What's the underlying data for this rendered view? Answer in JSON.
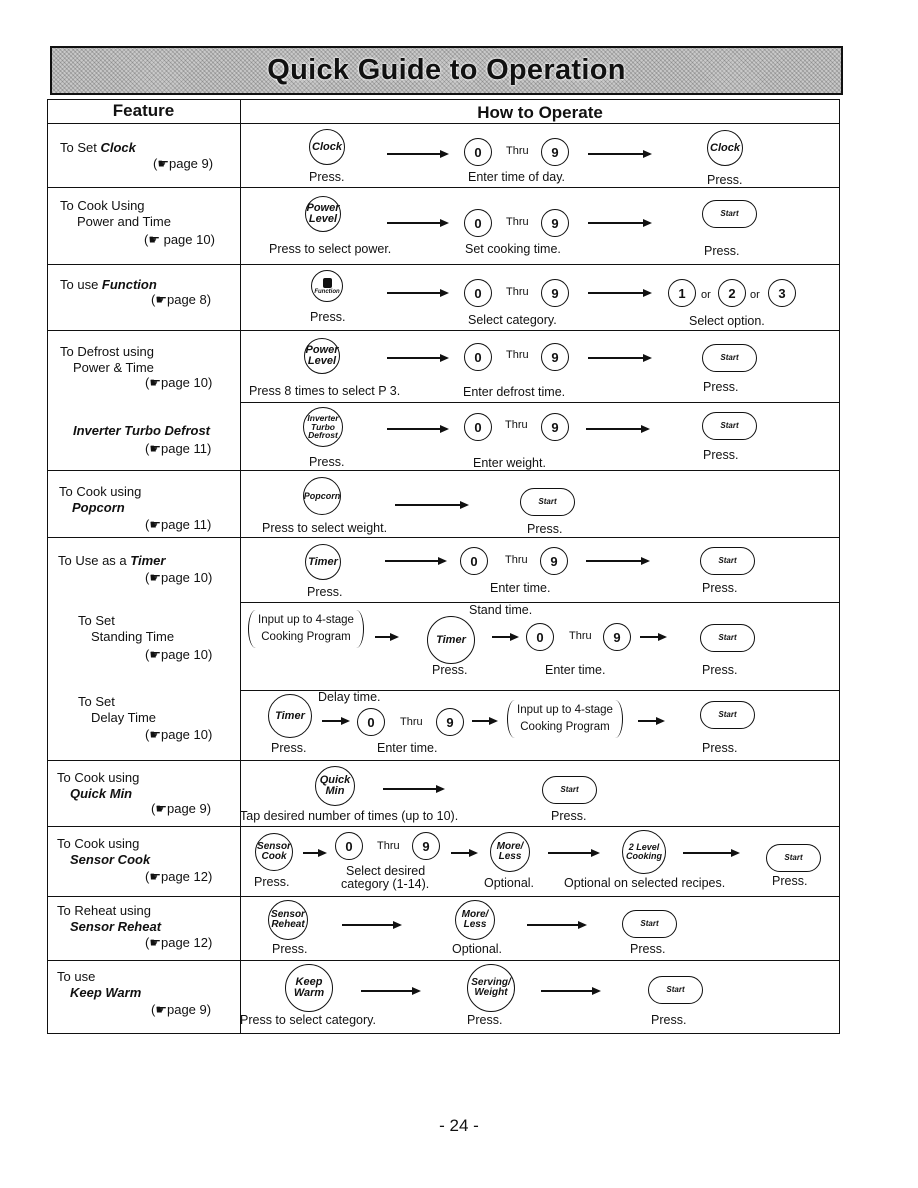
{
  "title": "Quick Guide to Operation",
  "headers": {
    "feature": "Feature",
    "how": "How to Operate"
  },
  "common": {
    "thru": "Thru",
    "or": "or",
    "press": "Press.",
    "start": "Start",
    "zero": "0",
    "nine": "9"
  },
  "rows": {
    "clock": {
      "line1": "To Set ",
      "em": "Clock",
      "ref": "(☛page 9)",
      "btn": "Clock",
      "cap1": "Press.",
      "cap2": "Enter time of day.",
      "cap3": "Press."
    },
    "power": {
      "line1": "To Cook Using",
      "line2": "Power and Time",
      "ref": "(☛ page 10)",
      "btn": "Power Level",
      "cap1": "Press to select power.",
      "cap2": "Set cooking time.",
      "cap3": "Press."
    },
    "function": {
      "line1": "To use ",
      "em": "Function",
      "ref": "(☛page 8)",
      "btn": "Function",
      "cap1": "Press.",
      "cap2": "Select category.",
      "opt1": "1",
      "opt2": "2",
      "opt3": "3",
      "cap3": "Select option."
    },
    "defrost": {
      "line1": "To Defrost using",
      "line2": "Power & Time",
      "ref": "(☛page 10)",
      "btn": "Power Level",
      "cap1": "Press 8 times to select P 3.",
      "cap2": "Enter defrost time.",
      "cap3": "Press."
    },
    "turbo": {
      "em": "Inverter Turbo Defrost",
      "ref": "(☛page 11)",
      "btn": "Inverter Turbo Defrost",
      "cap1": "Press.",
      "cap2": "Enter weight.",
      "cap3": "Press."
    },
    "popcorn": {
      "line1": "To Cook using",
      "em": "Popcorn",
      "ref": "(☛page 11)",
      "btn": "Popcorn",
      "cap1": "Press to select weight.",
      "cap2": "Press."
    },
    "timer": {
      "line1": "To Use as a ",
      "em": "Timer",
      "ref": "(☛page 10)",
      "btn": "Timer",
      "cap1": "Press.",
      "cap2": "Enter time.",
      "cap3": "Press."
    },
    "standing": {
      "line1": "To Set",
      "line2": "Standing Time",
      "ref": "(☛page 10)",
      "program": "Input up to 4-stage Cooking Program",
      "top": "Stand time.",
      "btn": "Timer",
      "cap1": "Press.",
      "cap2": "Enter time.",
      "cap3": "Press."
    },
    "delay": {
      "line1": "To Set",
      "line2": "Delay Time",
      "ref": "(☛page 10)",
      "top": "Delay time.",
      "btn": "Timer",
      "program": "Input up to 4-stage Cooking Program",
      "cap1": "Press.",
      "cap2": "Enter time.",
      "cap3": "Press."
    },
    "quickmin": {
      "line1": "To Cook using",
      "em": "Quick Min",
      "ref": "(☛page 9)",
      "btn": "Quick Min",
      "cap1": "Tap desired number of times (up to 10).",
      "cap2": "Press."
    },
    "sensorcook": {
      "line1": "To Cook using",
      "em": "Sensor Cook",
      "ref": "(☛page 12)",
      "btn": "Sensor Cook",
      "btn2": "More/ Less",
      "btn3": "2 Level Cooking",
      "cap1": "Press.",
      "cap2a": "Select desired",
      "cap2b": "category (1-14).",
      "cap3": "Optional.",
      "cap4": "Optional on selected recipes.",
      "cap5": "Press."
    },
    "reheat": {
      "line1": "To Reheat using",
      "em": "Sensor Reheat",
      "ref": "(☛page 12)",
      "btn": "Sensor Reheat",
      "btn2": "More/ Less",
      "cap1": "Press.",
      "cap2": "Optional.",
      "cap3": "Press."
    },
    "keepwarm": {
      "line1": "To use",
      "em": "Keep Warm",
      "ref": "(☛page 9)",
      "btn": "Keep Warm",
      "btn2": "Serving/ Weight",
      "cap1": "Press to select category.",
      "cap2": "Press.",
      "cap3": "Press."
    }
  },
  "page_number": "- 24 -"
}
